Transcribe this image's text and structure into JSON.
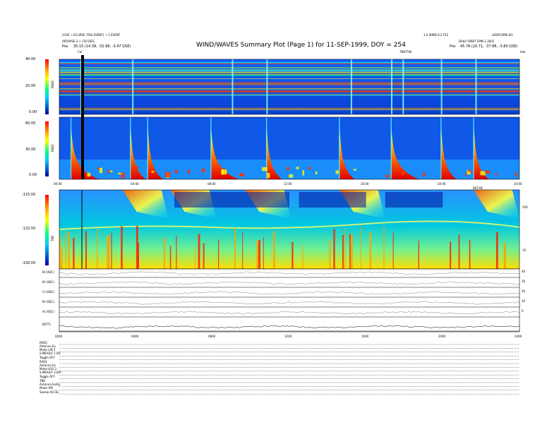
{
  "header": {
    "title": "WIND/WAVES Summary Plot (Page 1) for 11-SEP-1999, DOY = 254",
    "left_line1": "2330 → ECLIPSE (TDS EVENT) → 1 EVENT",
    "left_line2": "APOAPSE 3 + 150 DEG",
    "left_line3_label": "Pos",
    "left_line3_value": "35.15 (14.38, -32.98, -3.47 GSE)",
    "right_line1": "1.0 WIND 8.2 F02",
    "right_line2": "DAILY ORBIT SPIN 1.3002",
    "right_line3_label": "Pos",
    "right_line3_value": "45.78 (20.71, -37.88, -3.83 GSE)",
    "right_corner": "LDSPCOMS 8/1",
    "cal_marker": "Cal",
    "tnr_marker": "TNR/THE",
    "right_edge": "kHz"
  },
  "panels": {
    "rad2": {
      "label": "RAD2",
      "yticks": [
        "40.00",
        "20.00",
        "0.00"
      ],
      "cbar_colors": [
        "#ff0000",
        "#ffff00",
        "#00ffff",
        "#0000ff"
      ]
    },
    "rad1": {
      "label": "RAD1",
      "yticks": [
        "60.00",
        "30.00",
        "0.00"
      ],
      "xticks": [
        "00:00",
        "04:00",
        "08:00",
        "12:00",
        "16:00",
        "20:00",
        "24:00"
      ],
      "right_marker": "DEF:0E"
    },
    "tnr": {
      "label": "TNR",
      "yticks": [
        "-115.00",
        "-132.50",
        "-150.00"
      ],
      "right_ticks": [
        "100",
        "10"
      ]
    },
    "lines": {
      "labels": [
        "Bl (ADC)",
        "Bl (ADC)",
        "Cl (ADC)",
        "Bl (ADC)",
        "Al (ADC)",
        "IB(TT)"
      ],
      "right_ticks": [
        "40",
        "30",
        "20",
        "10",
        "0"
      ],
      "xticks": [
        "0000",
        "0400",
        "0800",
        "1200",
        "1600",
        "2000",
        "2400"
      ]
    }
  },
  "footer": {
    "rows": [
      {
        "label": "RAD2",
        "value": ""
      },
      {
        "label": "Antenna",
        "value": "Ey"
      },
      {
        "label": "Mode",
        "value": "LIN 3"
      },
      {
        "label": "S-MEAS/F",
        "value": "1.0/F"
      },
      {
        "label": "Toggle",
        "value": "OFF"
      },
      {
        "label": "RAD1",
        "value": ""
      },
      {
        "label": "Antenna",
        "value": "Ex"
      },
      {
        "label": "Mode",
        "value": "LOG 2"
      },
      {
        "label": "S-MEAS/F",
        "value": "3.0/A"
      },
      {
        "label": "Toggle",
        "value": "OFF"
      },
      {
        "label": "TNR",
        "value": ""
      },
      {
        "label": "Antenna",
        "value": "Ex/Ey"
      },
      {
        "label": "Mode",
        "value": "A/B"
      },
      {
        "label": "Sweep",
        "value": "ACCEL"
      }
    ]
  },
  "chart_data": [
    {
      "type": "heatmap",
      "title": "RAD2",
      "x": [
        "00:00",
        "04:00",
        "08:00",
        "12:00",
        "16:00",
        "20:00",
        "24:00"
      ],
      "ylim": [
        0,
        40
      ],
      "ylabel": "RAD2",
      "bursts_hours": [
        1.1,
        3.8,
        9.0,
        10.8,
        15.2,
        17.3,
        17.9,
        19.9,
        21.7
      ],
      "cbar_colors": [
        "#ff0000",
        "#ffff00",
        "#00ffff",
        "#0000ff"
      ]
    },
    {
      "type": "heatmap",
      "title": "RAD1",
      "x": [
        "00:00",
        "04:00",
        "08:00",
        "12:00",
        "16:00",
        "20:00",
        "24:00"
      ],
      "ylim": [
        0,
        60
      ],
      "ylabel": "RAD1",
      "bursts_hours": [
        0.6,
        3.7,
        4.6,
        7.9,
        10.8,
        14.6,
        17.3,
        19.9,
        21.6
      ]
    },
    {
      "type": "heatmap",
      "title": "TNR",
      "x": [
        "00:00",
        "04:00",
        "08:00",
        "12:00",
        "16:00",
        "20:00",
        "24:00"
      ],
      "ylim": [
        -150,
        -115
      ],
      "ylabel": "TNR",
      "bursts_hours": [
        3.3,
        5.8,
        9.7,
        14.6,
        21.6
      ]
    },
    {
      "type": "line",
      "title": "Lines",
      "x": [
        "0000",
        "0400",
        "0800",
        "1200",
        "1600",
        "2000",
        "2400"
      ],
      "series": [
        {
          "name": "Bl (ADC)"
        },
        {
          "name": "Bl (ADC)"
        },
        {
          "name": "Cl (ADC)"
        },
        {
          "name": "Bl (ADC)"
        },
        {
          "name": "Al (ADC)"
        },
        {
          "name": "IB(TT)"
        }
      ]
    }
  ]
}
